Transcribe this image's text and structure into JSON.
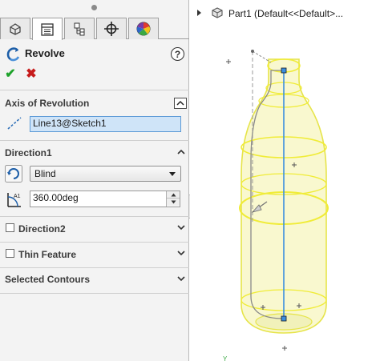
{
  "feature": {
    "title": "Revolve",
    "help_symbol": "?",
    "ok_symbol": "✔",
    "cancel_symbol": "✖"
  },
  "tabs": [
    {
      "icon": "feature-manager-icon"
    },
    {
      "icon": "property-manager-icon",
      "active": true
    },
    {
      "icon": "configuration-manager-icon"
    },
    {
      "icon": "dimxpert-manager-icon"
    },
    {
      "icon": "display-manager-icon"
    }
  ],
  "axis_section": {
    "label": "Axis of Revolution",
    "axis_value": "Line13@Sketch1"
  },
  "direction1": {
    "label": "Direction1",
    "end_condition": "Blind",
    "angle": "360.00deg"
  },
  "direction2": {
    "label": "Direction2",
    "checked": false
  },
  "thin_feature": {
    "label": "Thin Feature",
    "checked": false
  },
  "selected_contours": {
    "label": "Selected Contours"
  },
  "tree": {
    "part_label": "Part1  (Default<<Default>..."
  },
  "colors": {
    "accept": "#1ea22a",
    "cancel": "#c61b1b",
    "selection_field": "#cfe4f8",
    "preview_yellow": "#f2f06a",
    "axis_blue": "#3b8fe0"
  }
}
